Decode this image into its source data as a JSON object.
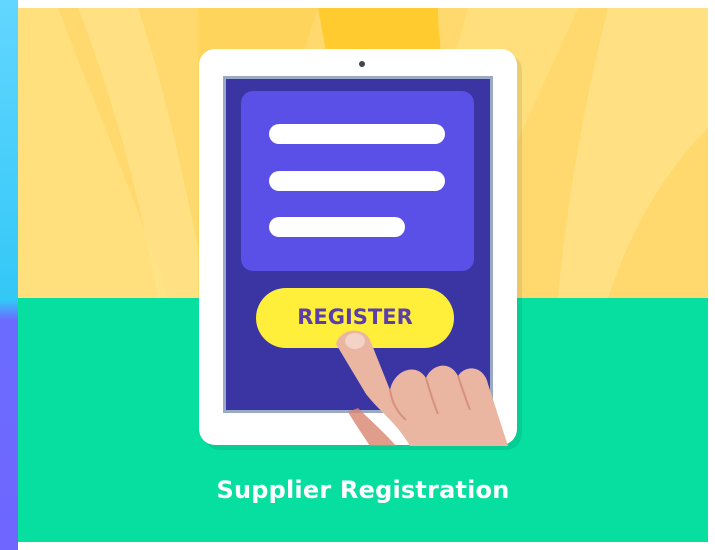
{
  "banner": {
    "button_label": "REGISTER",
    "title": "Supplier Registration"
  },
  "icons": {
    "device": "tablet-icon",
    "pointer": "finger-pointing-hand-icon"
  },
  "colors": {
    "top_background": "#ffd96e",
    "bottom_background": "#06dfa0",
    "screen": "#3b35a3",
    "form_panel": "#5a4fe6",
    "button": "#ffee3a",
    "button_text": "#5b3fa8",
    "title_text": "#ffffff"
  }
}
